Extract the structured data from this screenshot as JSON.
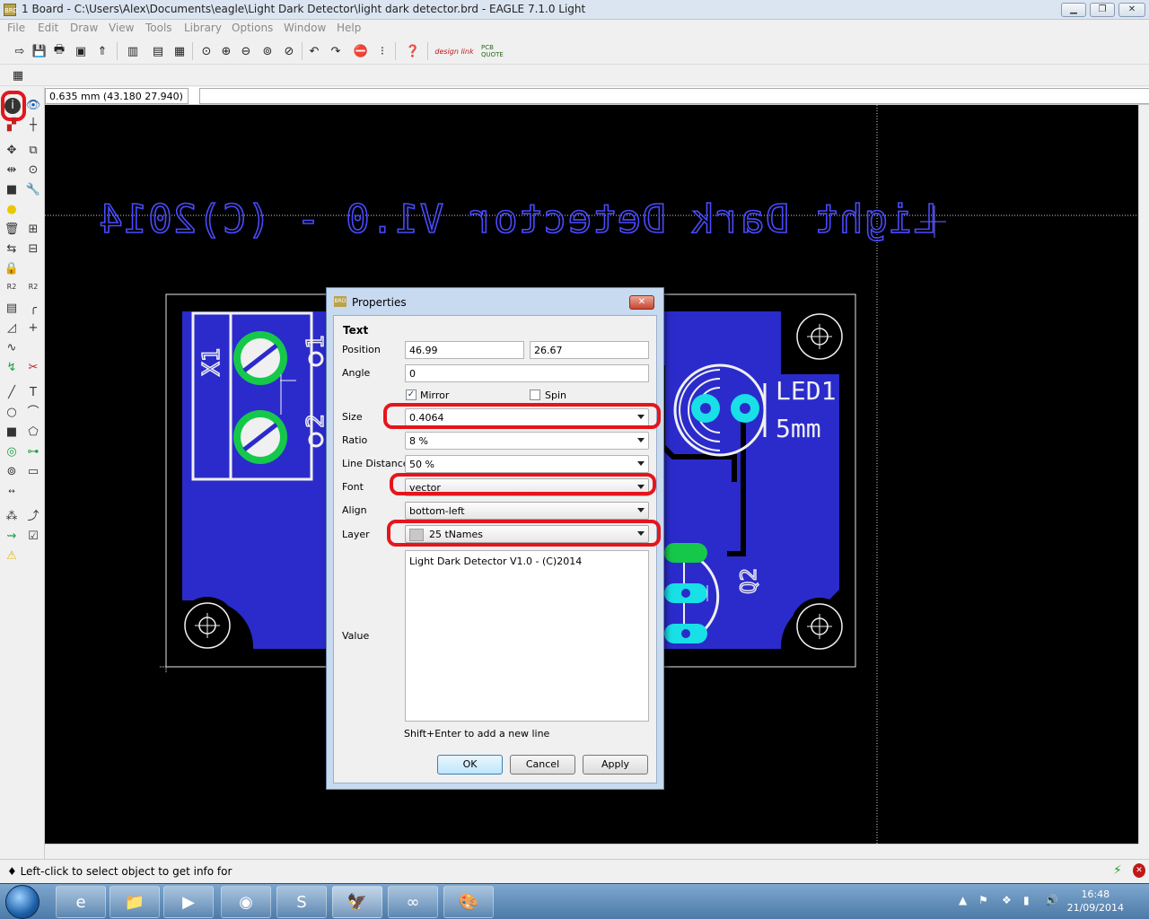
{
  "window": {
    "title": "1 Board - C:\\Users\\Alex\\Documents\\eagle\\Light Dark Detector\\light dark detector.brd - EAGLE 7.1.0 Light",
    "app_icon": "BRD"
  },
  "menu": [
    "File",
    "Edit",
    "Draw",
    "View",
    "Tools",
    "Library",
    "Options",
    "Window",
    "Help"
  ],
  "toolbar": {
    "designlink": "design link",
    "pcbquote": "PCB QUOTE"
  },
  "coord": {
    "value": "0.635 mm (43.180 27.940)"
  },
  "board": {
    "mirrored_text": "Light Dark Detector V1.0 - (C)2014",
    "x1": "X1",
    "pin1": "1",
    "pin2": "2",
    "led_name": "LED1",
    "led_value": "5mm",
    "q2": "Q2",
    "colors": {
      "copper": "#2b2bcc",
      "silk": "#f0f0f0",
      "pad": "#18e0e6",
      "via_green": "#15c84a"
    }
  },
  "dialog": {
    "title": "Properties",
    "icon": "BRD",
    "section": "Text",
    "position_label": "Position",
    "position_x": "46.99",
    "position_y": "26.67",
    "angle_label": "Angle",
    "angle": "0",
    "mirror_label": "Mirror",
    "mirror_checked": true,
    "spin_label": "Spin",
    "spin_checked": false,
    "size_label": "Size",
    "size": "0.4064",
    "ratio_label": "Ratio",
    "ratio": "8 %",
    "linedist_label": "Line Distance",
    "linedist": "50 %",
    "font_label": "Font",
    "font": "vector",
    "align_label": "Align",
    "align": "bottom-left",
    "layer_label": "Layer",
    "layer": "25 tNames",
    "value_label": "Value",
    "value": "Light Dark Detector V1.0 - (C)2014",
    "hint": "Shift+Enter to add a new line",
    "ok": "OK",
    "cancel": "Cancel",
    "apply": "Apply"
  },
  "status": {
    "text": "♦ Left-click to select object to get info for"
  },
  "taskbar": {
    "time": "16:48",
    "date": "21/09/2014"
  }
}
